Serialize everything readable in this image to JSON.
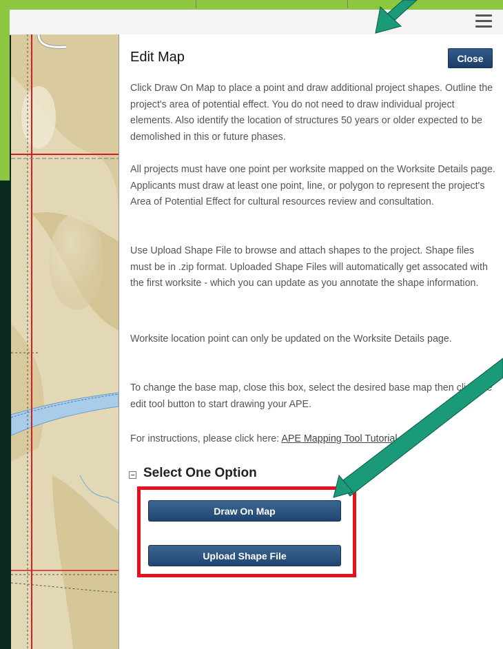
{
  "header": {
    "menu_icon": "hamburger-icon"
  },
  "panel": {
    "title": "Edit Map",
    "close_label": "Close",
    "paragraphs": [
      "Click Draw On Map to place a point and draw additional project shapes. Outline the project's area of potential effect. You do not need to draw individual project elements. Also identify the location of structures 50 years or older expected to be demolished in this or future phases.",
      "All projects must have one point per worksite mapped on the Worksite Details page. Applicants must draw at least one point, line, or polygon to represent the project's Area of Potential Effect for cultural resources review and consultation.",
      "Use Upload Shape File to browse and attach shapes to the project. Shape files must be in .zip format. Uploaded Shape Files will automatically get assocated with the first worksite - which you can update as you annotate the shape information.",
      "Worksite location point can only be updated on the Worksite Details page.",
      "To change the base map, close this box, select the desired base map then click the edit tool button to start drawing your APE."
    ],
    "instructions_prefix": "For instructions, please click here: ",
    "instructions_link": "APE Mapping Tool Tutorial.",
    "section_title": "Select One Option",
    "draw_button": "Draw On Map",
    "upload_button": "Upload Shape File"
  },
  "annotations": {
    "frame_color": "#8dc63f",
    "arrow_color": "#1a9a78",
    "highlight_color": "#e8111b"
  }
}
